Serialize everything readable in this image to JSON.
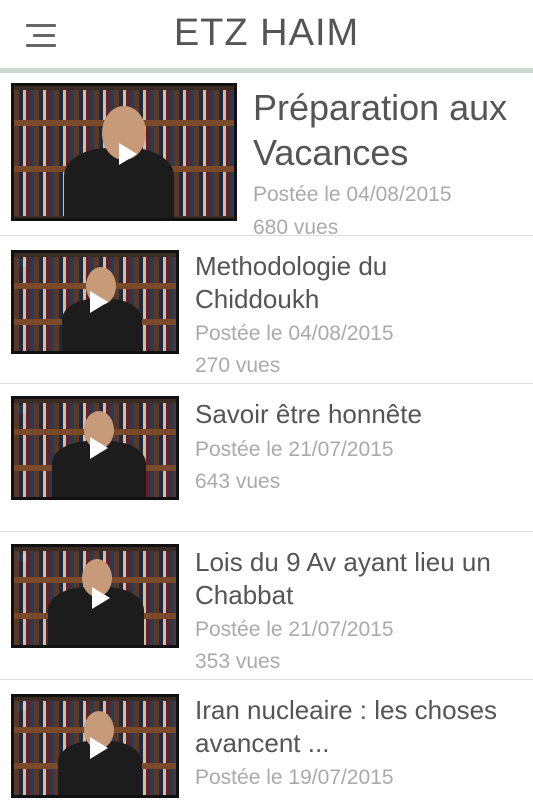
{
  "header": {
    "title": "ETZ HAIM"
  },
  "videos": [
    {
      "title": "Préparation aux Vacances",
      "posted": "Postée le 04/08/2015",
      "views": "680 vues"
    },
    {
      "title": "Methodologie du Chiddoukh",
      "posted": "Postée le 04/08/2015",
      "views": "270 vues"
    },
    {
      "title": "Savoir être honnête",
      "posted": "Postée le 21/07/2015",
      "views": "643 vues"
    },
    {
      "title": "Lois du 9 Av ayant lieu un Chabbat",
      "posted": "Postée le 21/07/2015",
      "views": "353 vues"
    },
    {
      "title": "Iran nucleaire : les choses avancent ...",
      "posted": "Postée le 19/07/2015",
      "views": ""
    }
  ],
  "icons": {
    "menu": "hamburger-menu-icon",
    "play": "play-icon"
  },
  "colors": {
    "header_rule": "#c8d8d0",
    "text": "#555555",
    "meta": "#aaaaaa"
  }
}
